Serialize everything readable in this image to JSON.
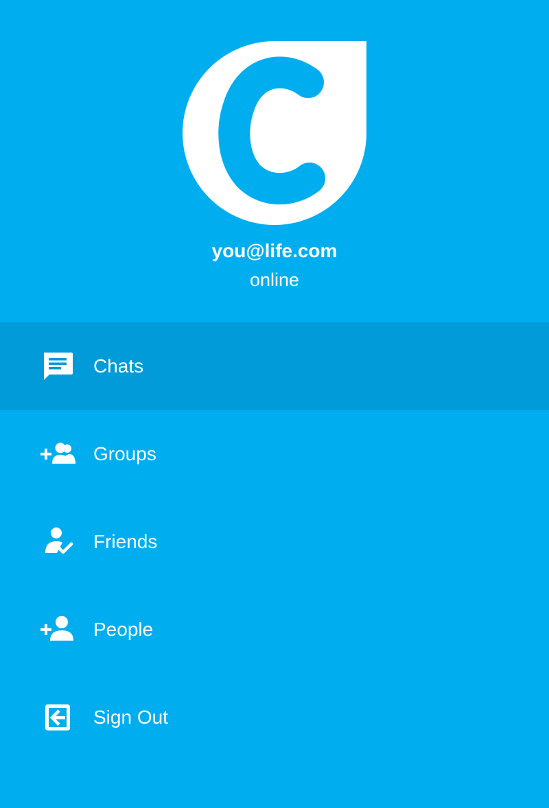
{
  "profile": {
    "email": "you@life.com",
    "status": "online"
  },
  "menu": {
    "items": [
      {
        "label": "Chats",
        "icon": "chat-icon",
        "active": true
      },
      {
        "label": "Groups",
        "icon": "add-group-icon",
        "active": false
      },
      {
        "label": "Friends",
        "icon": "friend-check-icon",
        "active": false
      },
      {
        "label": "People",
        "icon": "add-person-icon",
        "active": false
      },
      {
        "label": "Sign Out",
        "icon": "sign-out-icon",
        "active": false
      }
    ]
  },
  "colors": {
    "background": "#00AEEF",
    "active_item": "#009BD8",
    "foreground": "#FFFFFF"
  }
}
